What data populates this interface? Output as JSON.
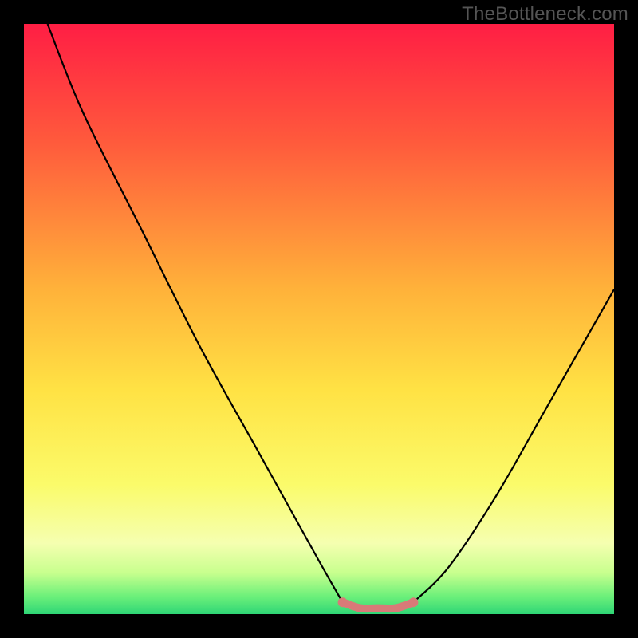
{
  "watermark": "TheBottleneck.com",
  "gradient_stops": [
    {
      "offset": 0.0,
      "color": "#ff1e44"
    },
    {
      "offset": 0.2,
      "color": "#ff5a3c"
    },
    {
      "offset": 0.45,
      "color": "#ffb23a"
    },
    {
      "offset": 0.62,
      "color": "#ffe244"
    },
    {
      "offset": 0.78,
      "color": "#fbfb6a"
    },
    {
      "offset": 0.88,
      "color": "#f5ffb0"
    },
    {
      "offset": 0.93,
      "color": "#c8ff8e"
    },
    {
      "offset": 0.97,
      "color": "#6cf07a"
    },
    {
      "offset": 1.0,
      "color": "#2fd676"
    }
  ],
  "curve_color": "#000000",
  "curve_width": 2.2,
  "flat_segment": {
    "color": "#d87a78",
    "width": 10,
    "endpoint_radius": 6
  },
  "chart_data": {
    "type": "line",
    "title": "",
    "xlabel": "",
    "ylabel": "",
    "xlim": [
      0,
      100
    ],
    "ylim": [
      0,
      100
    ],
    "note": "Axes are implicit (no tick labels present). Values estimated from curve geometry relative to plot-area extent.",
    "series": [
      {
        "name": "left-branch",
        "x": [
          4,
          10,
          20,
          30,
          40,
          50,
          54
        ],
        "y": [
          100,
          85,
          65,
          45,
          27,
          9,
          2
        ]
      },
      {
        "name": "flat-highlight",
        "x": [
          54,
          57,
          60,
          63,
          66
        ],
        "y": [
          2,
          1,
          1,
          1,
          2
        ]
      },
      {
        "name": "right-branch",
        "x": [
          66,
          72,
          80,
          88,
          96,
          100
        ],
        "y": [
          2,
          8,
          20,
          34,
          48,
          55
        ]
      }
    ]
  }
}
